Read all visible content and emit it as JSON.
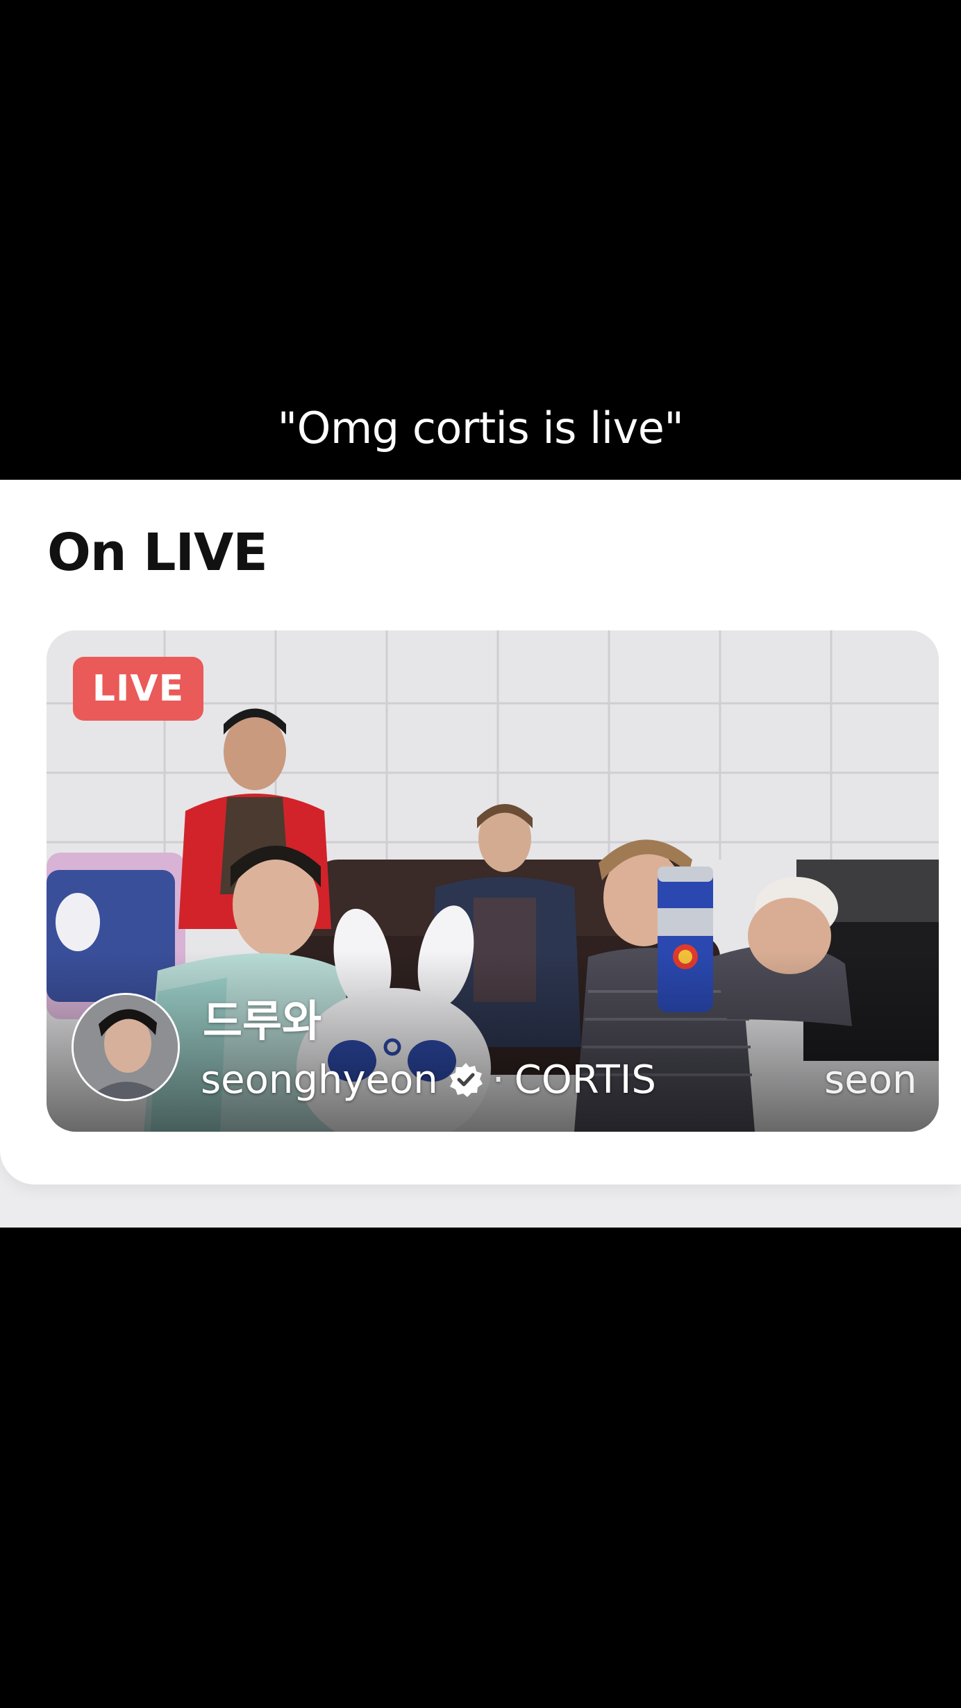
{
  "caption": "\"Omg cortis is live\"",
  "section": {
    "title": "On LIVE"
  },
  "live_tile": {
    "badge": "LIVE",
    "title": "드루와",
    "host_name": "seonghyeon",
    "group": "CORTIS",
    "next_name_partial": "seong",
    "verified_icon": "verified-badge-icon",
    "colors": {
      "badge": "#ea5a58"
    }
  }
}
